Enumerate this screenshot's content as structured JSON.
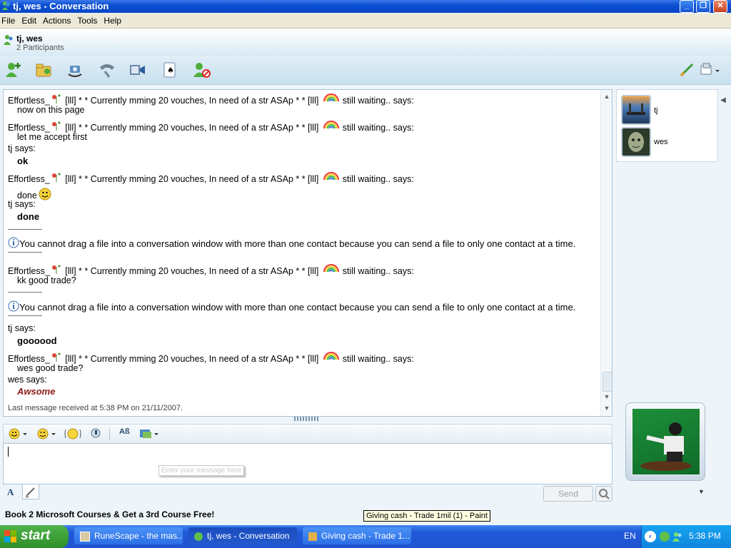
{
  "window": {
    "title": "tj, wes - Conversation",
    "minimize": "_",
    "maximize": "❐",
    "close": "✕"
  },
  "menu": [
    "File",
    "Edit",
    "Actions",
    "Tools",
    "Help"
  ],
  "header": {
    "participants": "tj, wes",
    "count": "2 Participants"
  },
  "toolbar": {
    "icons": [
      "invite-contact-icon",
      "share-folder-icon",
      "video-call-icon",
      "phone-call-icon",
      "video-clip-icon",
      "games-icon",
      "block-contact-icon"
    ],
    "right_icons": [
      "paint-brush-icon",
      "display-options-icon"
    ]
  },
  "history": [
    {
      "type": "sender",
      "sender": "Effortless_",
      "mid": " [lll] * * Currently mming 20 vouches, In need of a str ASAp * * [lll]",
      "end": " still waiting.. says:"
    },
    {
      "type": "text",
      "text": "now on this page"
    },
    {
      "type": "sender",
      "sender": "Effortless_",
      "mid": " [lll] * * Currently mming 20 vouches, In need of a str ASAp * * [lll]",
      "end": " still waiting.. says:"
    },
    {
      "type": "text",
      "text": "let me accept first"
    },
    {
      "type": "says",
      "text": "tj says:"
    },
    {
      "type": "bold",
      "text": "ok"
    },
    {
      "type": "sender",
      "sender": "Effortless_",
      "mid": " [lll] * * Currently mming 20 vouches, In need of a str ASAp * * [lll]",
      "end": " still waiting.. says:"
    },
    {
      "type": "text",
      "text": "done"
    },
    {
      "type": "says",
      "text": "tj says:"
    },
    {
      "type": "bold",
      "text": "done"
    },
    {
      "type": "info",
      "text": "You cannot drag a file into a conversation window with more than one contact because you can send a file to only one contact at a time."
    },
    {
      "type": "sender",
      "sender": "Effortless_",
      "mid": " [lll] * * Currently mming 20 vouches, In need of a str ASAp * * [lll]",
      "end": " still waiting.. says:"
    },
    {
      "type": "text",
      "text": "kk good trade?"
    },
    {
      "type": "info",
      "text": "You cannot drag a file into a conversation window with more than one contact because you can send a file to only one contact at a time."
    },
    {
      "type": "says",
      "text": "tj says:"
    },
    {
      "type": "bold",
      "text": "goooood"
    },
    {
      "type": "sender",
      "sender": "Effortless_",
      "mid": " [lll] * * Currently mming 20 vouches, In need of a str ASAp * * [lll]",
      "end": " still waiting.. says:"
    },
    {
      "type": "text",
      "text": "wes good trade?"
    },
    {
      "type": "says",
      "text": "wes says:"
    },
    {
      "type": "awsome",
      "text": "Awsome"
    }
  ],
  "status": "Last message received at 5:38 PM on 21/11/2007.",
  "participants": [
    {
      "name": "tj"
    },
    {
      "name": "wes"
    }
  ],
  "input": {
    "placeholder": "Enter your message here"
  },
  "send_label": "Send",
  "ad": "Book 2 Microsoft Courses & Get a 3rd Course Free!",
  "tooltip": "Giving cash - Trade 1mil (1) - Paint",
  "taskbar": {
    "start": "start",
    "tasks": [
      "RuneScape - the mas...",
      "tj, wes - Conversation",
      "Giving cash - Trade 1..."
    ],
    "lang": "EN",
    "clock": "5:38 PM"
  },
  "colors": {
    "awsome": "#8b1a1a",
    "accent": "#0a4fd2"
  }
}
